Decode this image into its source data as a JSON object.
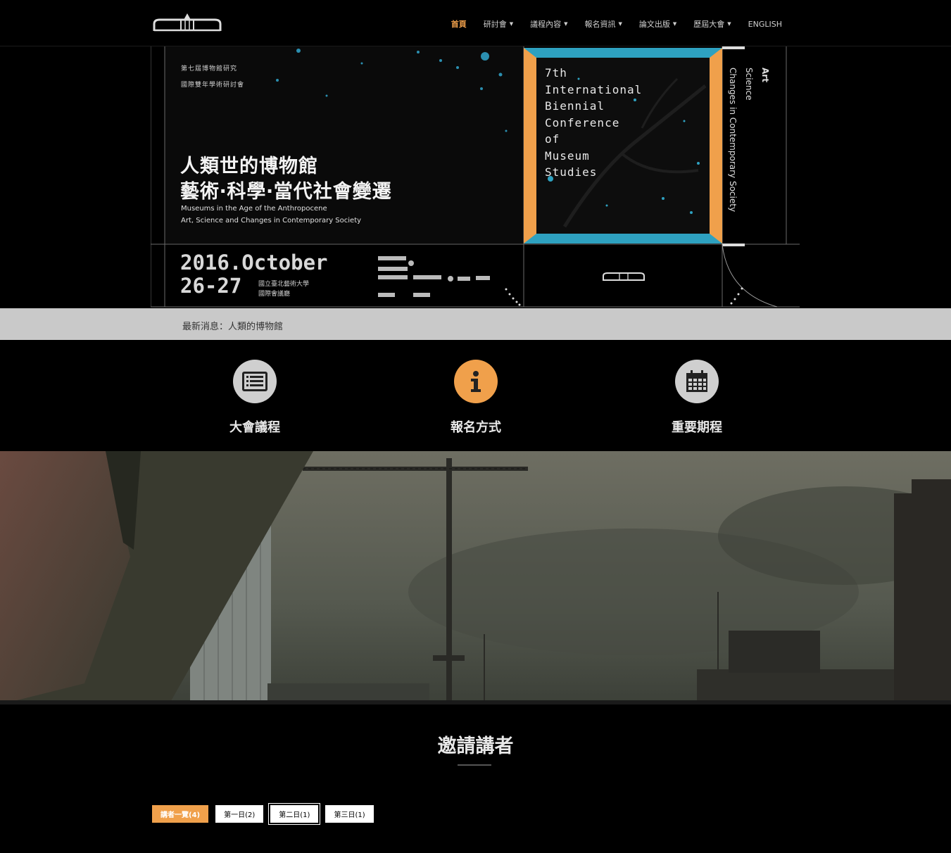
{
  "nav": {
    "items": [
      {
        "label": "首頁",
        "dropdown": false,
        "active": true
      },
      {
        "label": "研討會",
        "dropdown": true,
        "active": false
      },
      {
        "label": "議程內容",
        "dropdown": true,
        "active": false
      },
      {
        "label": "報名資訊",
        "dropdown": true,
        "active": false
      },
      {
        "label": "論文出版",
        "dropdown": true,
        "active": false
      },
      {
        "label": "歷屆大會",
        "dropdown": true,
        "active": false
      },
      {
        "label": "ENGLISH",
        "dropdown": false,
        "active": false
      }
    ],
    "active_color": "#f0a04b"
  },
  "hero": {
    "series_line1": "第七屆博物館研究",
    "series_line2": "國際雙年學術研討會",
    "title_zh_line1": "人類世的博物館",
    "title_zh_line2": "藝術‧科學‧當代社會變遷",
    "title_en_line1": "Museums in the Age of the Anthropocene",
    "title_en_line2": "Art, Science and Changes in Contemporary Society",
    "date_line1": "2016.October",
    "date_line2": "26-27",
    "venue_line1": "國立臺北藝術大學",
    "venue_line2": "國際會議廳",
    "poster_lines": [
      "7th",
      "International",
      "Biennial",
      "Conference",
      "of",
      "Museum",
      "Studies"
    ],
    "vertical_1": "Art",
    "vertical_2": "Science",
    "vertical_3": "Changes in Contemporary Society",
    "accent_orange": "#f0a04b",
    "accent_blue": "#2ea1c0"
  },
  "news": {
    "label": "最新消息：人類的博物館"
  },
  "features": [
    {
      "label": "大會議程",
      "icon": "list-icon",
      "color": "#cfcfcf"
    },
    {
      "label": "報名方式",
      "icon": "info-icon",
      "color": "#f0a04b"
    },
    {
      "label": "重要期程",
      "icon": "calendar-icon",
      "color": "#cfcfcf"
    }
  ],
  "speakers": {
    "title": "邀請講者",
    "tabs": [
      {
        "label": "講者一覽(4)",
        "active": true
      },
      {
        "label": "第一日(2)",
        "active": false
      },
      {
        "label": "第二日(1)",
        "active": false
      },
      {
        "label": "第三日(1)",
        "active": false
      }
    ]
  }
}
